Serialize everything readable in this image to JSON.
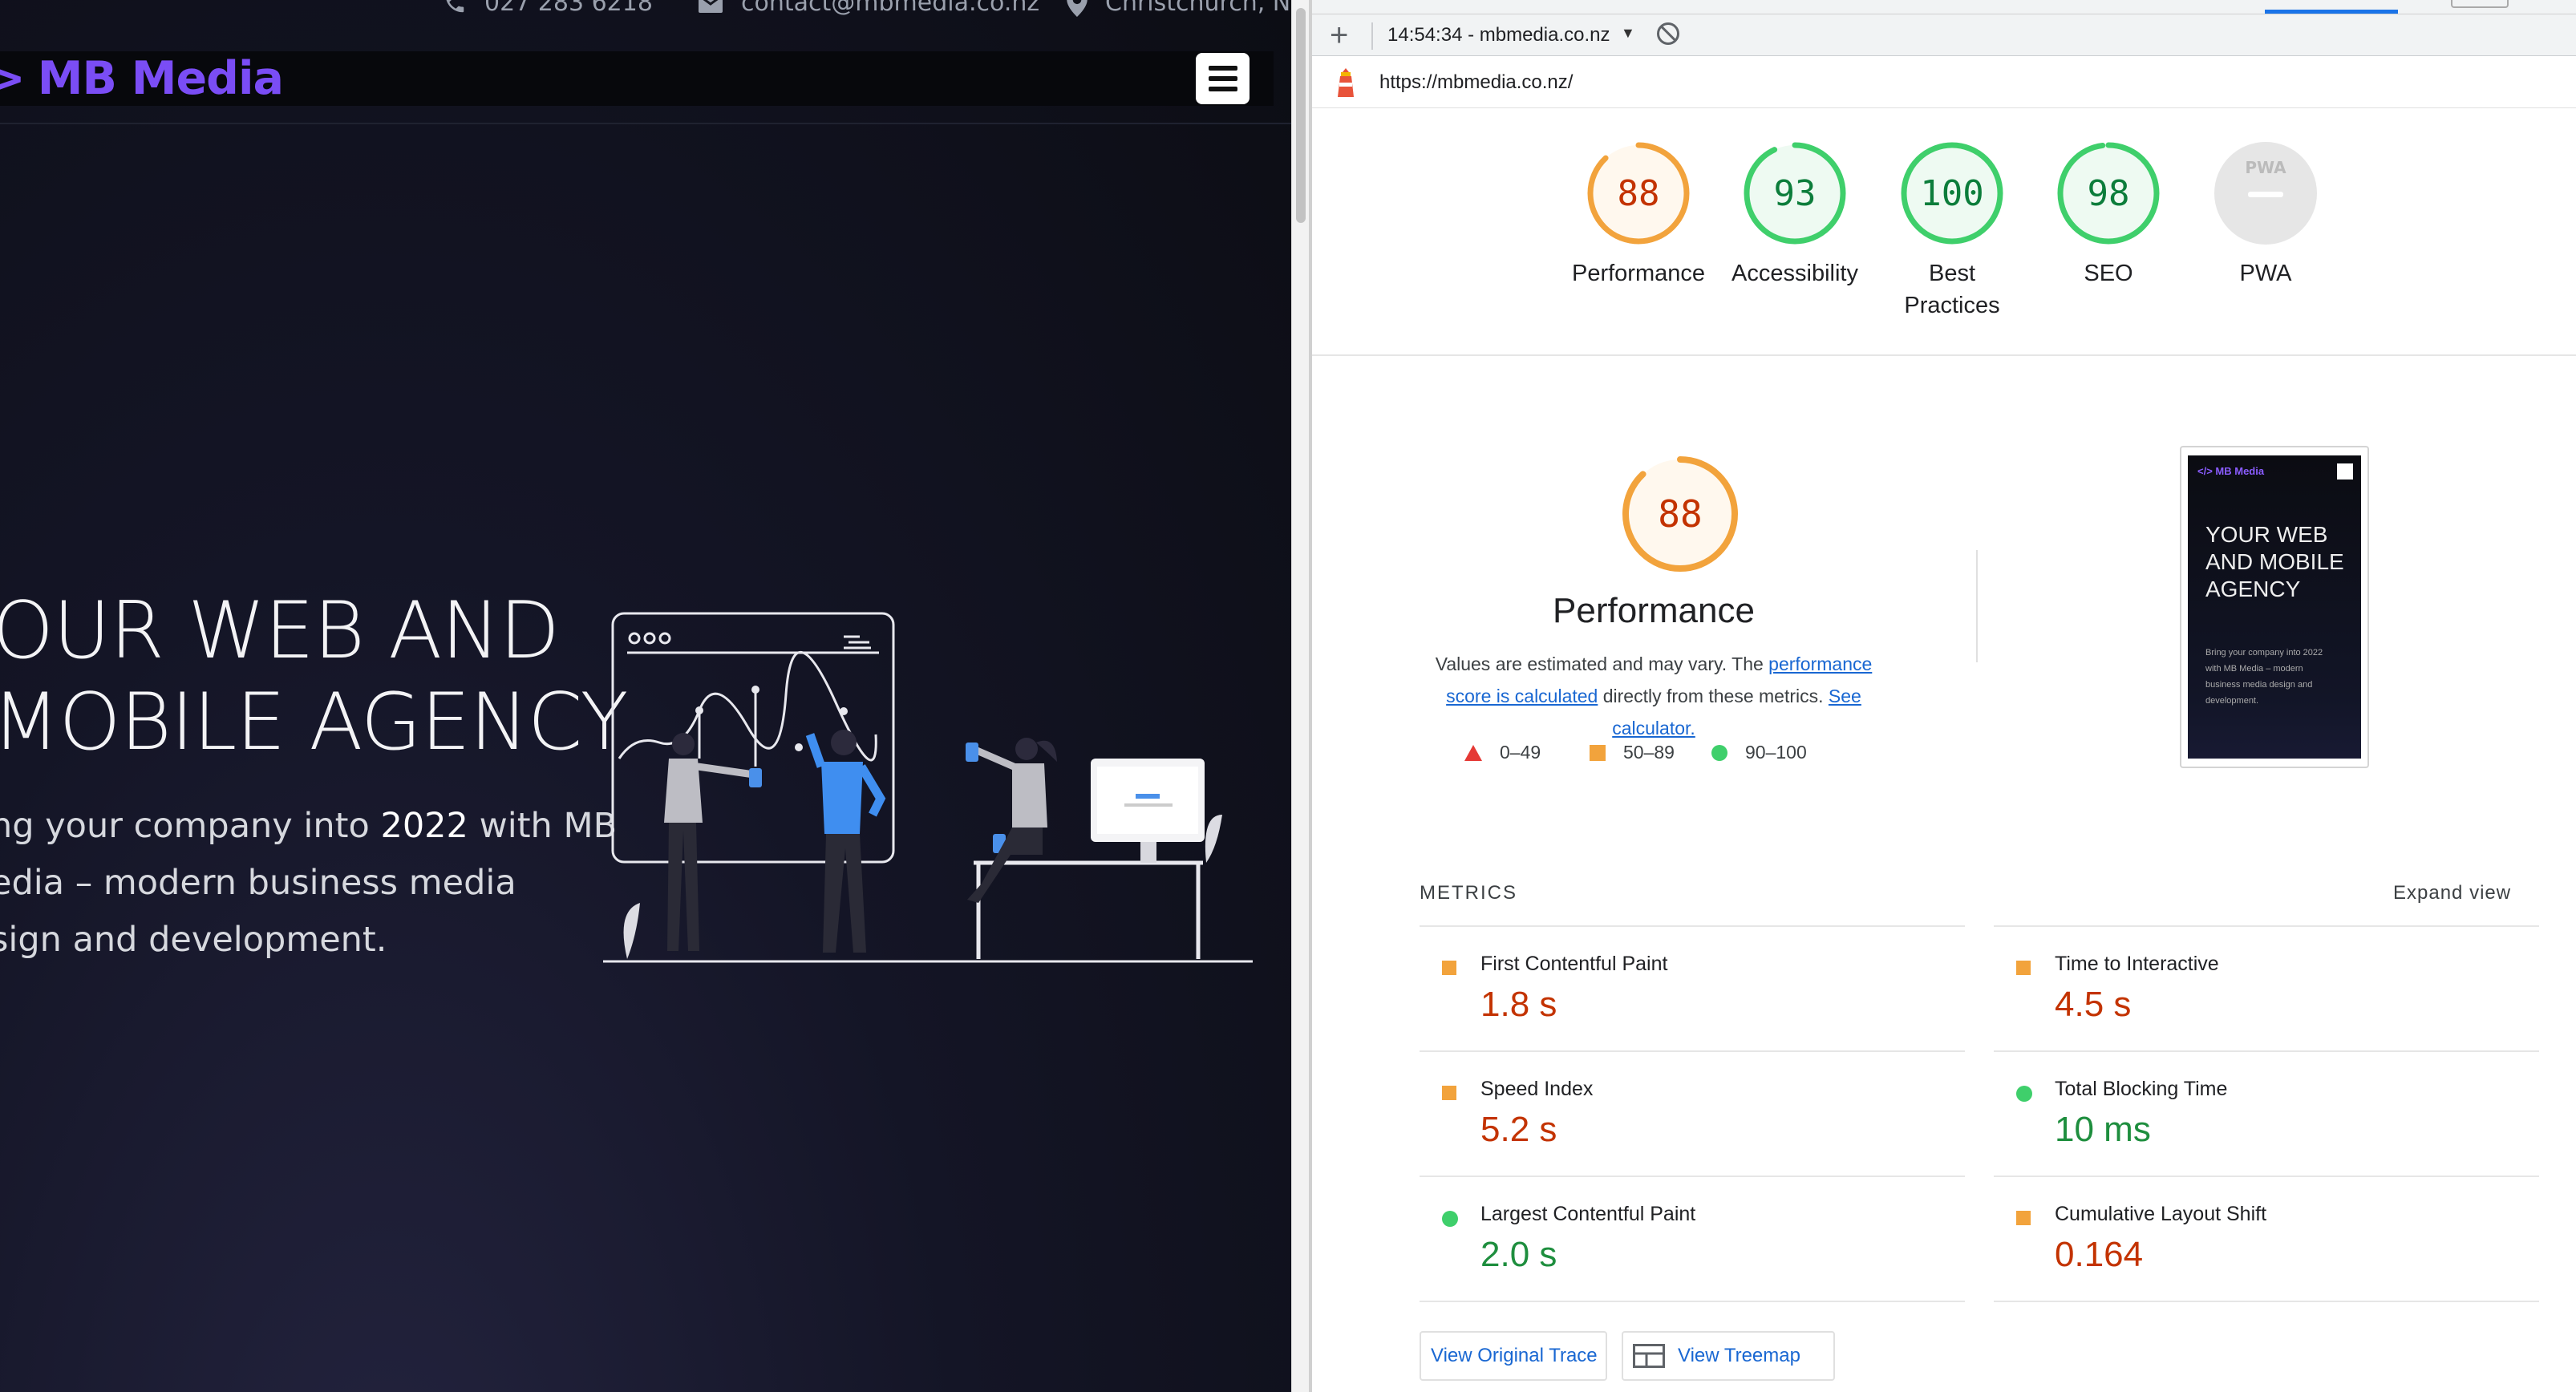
{
  "site": {
    "topbar": {
      "phone": "027 283 6218",
      "email": "contact@mbmedia.co.nz",
      "location": "Christchurch, NZ"
    },
    "brand": "MB Media",
    "hero": {
      "title_line1": "OUR WEB AND",
      "title_line2": "MOBILE AGENCY",
      "sub_line1_pre": "ng your company into ",
      "sub_line1_year": "2022",
      "sub_line1_post": " with MB",
      "sub_line2": "edia – modern business media",
      "sub_line3": "sign and development."
    }
  },
  "devtools": {
    "report_selector": "14:54:34 - mbmedia.co.nz",
    "url": "https://mbmedia.co.nz/",
    "scores": [
      {
        "value": "88",
        "label": "Performance",
        "score": 0.88,
        "color": "#f2a33c",
        "text_color": "#c33300",
        "bg": "#fff8ee"
      },
      {
        "value": "93",
        "label": "Accessibility",
        "score": 0.93,
        "color": "#3fcf6b",
        "text_color": "#0c7d3b",
        "bg": "#eefaf2"
      },
      {
        "value": "100",
        "label_line1": "Best",
        "label_line2": "Practices",
        "score": 1.0,
        "color": "#3fcf6b",
        "text_color": "#0c7d3b",
        "bg": "#eefaf2"
      },
      {
        "value": "98",
        "label": "SEO",
        "score": 0.98,
        "color": "#3fcf6b",
        "text_color": "#0c7d3b",
        "bg": "#eefaf2"
      },
      {
        "badge": "PWA",
        "label": "PWA",
        "color": "#cccccc"
      }
    ],
    "performance": {
      "score": "88",
      "title": "Performance",
      "desc_pre": "Values are estimated and may vary. The ",
      "desc_link1": "performance score is calculated",
      "desc_mid": " directly from these metrics. ",
      "desc_link2": "See calculator.",
      "legend": [
        "0–49",
        "50–89",
        "90–100"
      ]
    },
    "thumbnail": {
      "brand": "</> MB Media",
      "title": "YOUR WEB AND MOBILE AGENCY",
      "sub": "Bring your company into 2022 with MB Media – modern business media design and development."
    },
    "metrics_label": "METRICS",
    "expand_label": "Expand view",
    "metrics": [
      {
        "name": "First Contentful Paint",
        "value": "1.8 s",
        "status": "average"
      },
      {
        "name": "Time to Interactive",
        "value": "4.5 s",
        "status": "average"
      },
      {
        "name": "Speed Index",
        "value": "5.2 s",
        "status": "average"
      },
      {
        "name": "Total Blocking Time",
        "value": "10 ms",
        "status": "pass"
      },
      {
        "name": "Largest Contentful Paint",
        "value": "2.0 s",
        "status": "pass"
      },
      {
        "name": "Cumulative Layout Shift",
        "value": "0.164",
        "status": "average"
      }
    ],
    "buttons": {
      "trace": "View Original Trace",
      "treemap": "View Treemap"
    }
  }
}
